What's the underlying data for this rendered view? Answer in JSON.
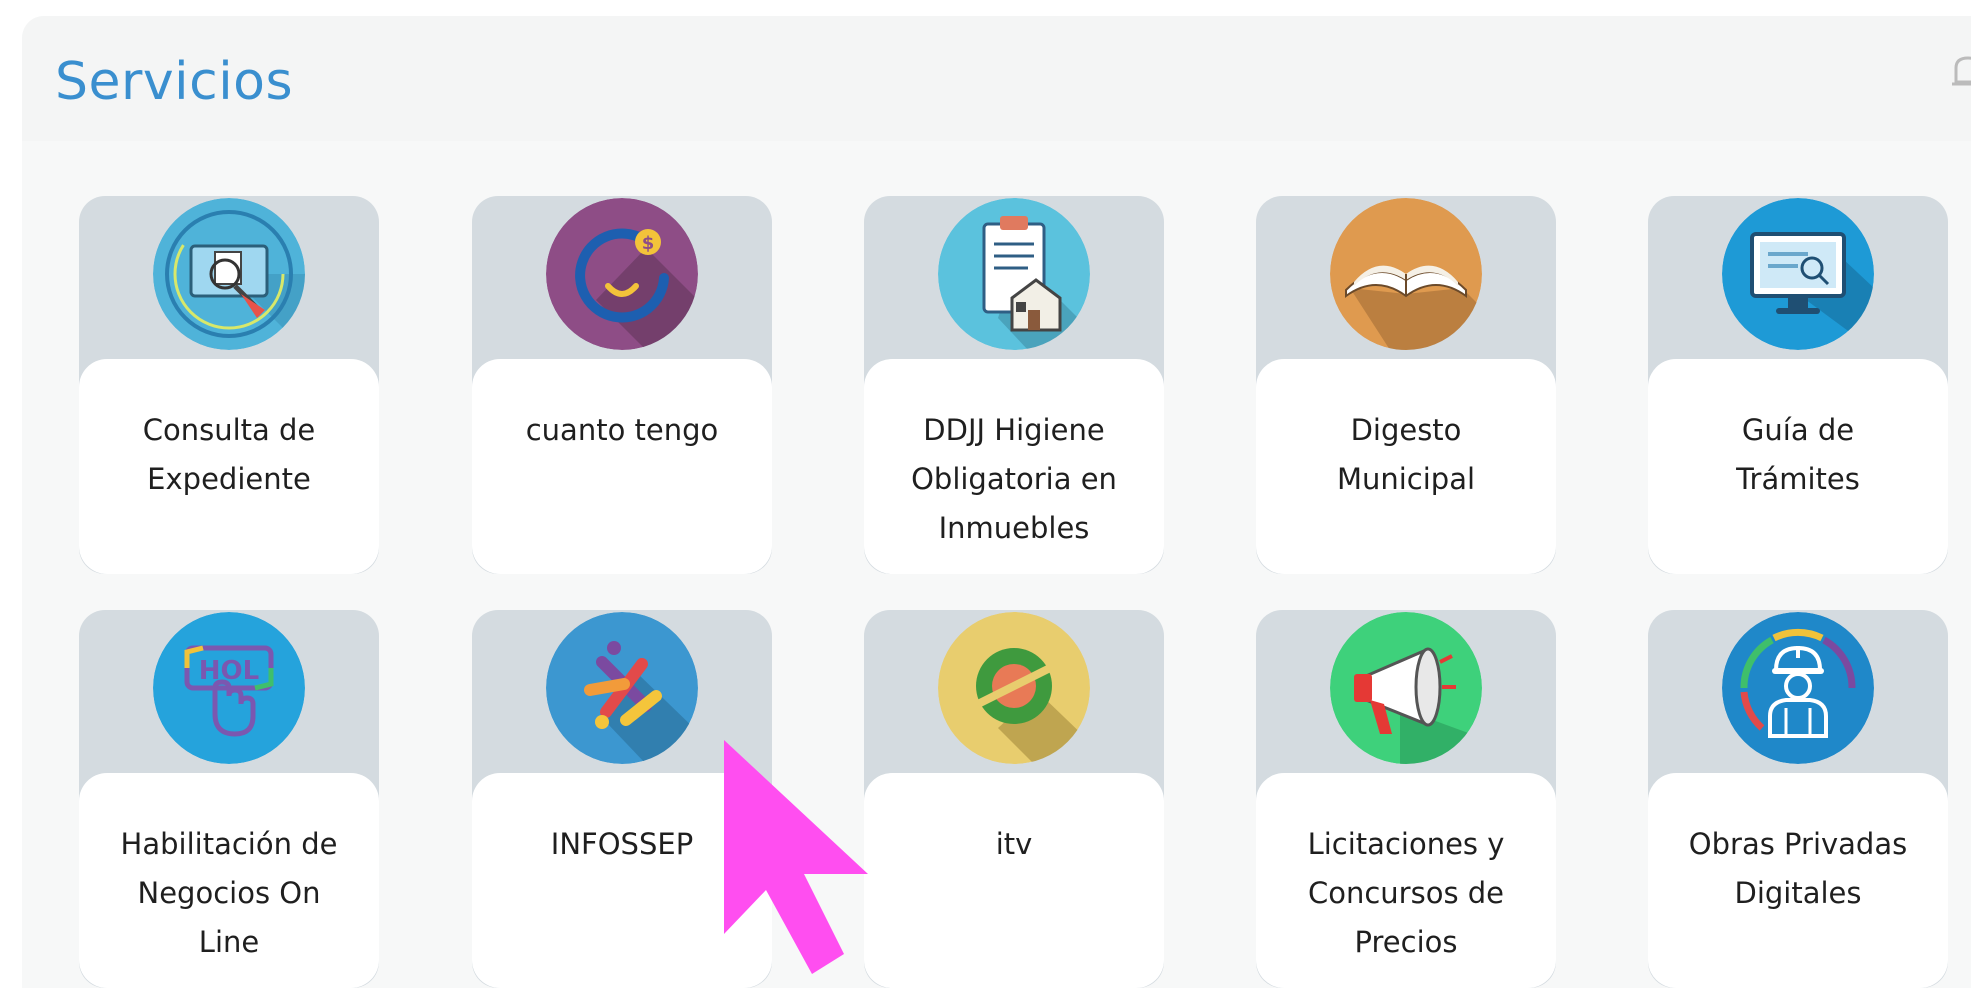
{
  "header": {
    "title": "Servicios"
  },
  "services": [
    {
      "label": "Consulta de\nExpediente",
      "icon": "document-monitor-icon",
      "color": "#4fb3d9"
    },
    {
      "label": "cuanto tengo",
      "icon": "money-smile-icon",
      "color": "#8e4d86"
    },
    {
      "label": "DDJJ Higiene\nObligatoria en\nInmuebles",
      "icon": "clipboard-house-icon",
      "color": "#5bc2dd"
    },
    {
      "label": "Digesto\nMunicipal",
      "icon": "open-book-icon",
      "color": "#df9a4f"
    },
    {
      "label": "Guía de\nTrámites",
      "icon": "monitor-search-icon",
      "color": "#1e9ad6"
    },
    {
      "label": "Habilitación de\nNegocios On\nLine",
      "icon": "hand-touch-sign-icon",
      "color": "#25a3dc"
    },
    {
      "label": "INFOSSEP",
      "icon": "infossep-logo-icon",
      "color": "#3c97d0"
    },
    {
      "label": "itv",
      "icon": "itv-target-icon",
      "color": "#e8cd6e"
    },
    {
      "label": "Licitaciones y\nConcursos de\nPrecios",
      "icon": "megaphone-icon",
      "color": "#3ed17b"
    },
    {
      "label": "Obras Privadas\nDigitales",
      "icon": "construction-worker-icon",
      "color": "#1f88c9"
    }
  ]
}
